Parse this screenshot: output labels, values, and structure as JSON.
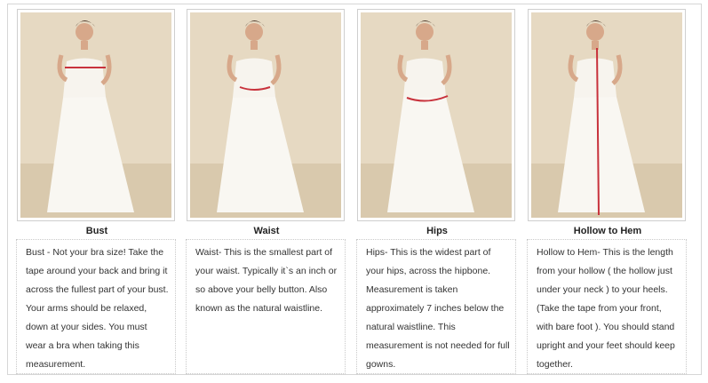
{
  "columns": [
    {
      "title": "Bust",
      "text": "Bust - Not your bra size! Take the tape around your back and bring it across the fullest part of your bust. Your arms should be relaxed, down at your sides. You must wear a bra when taking this measurement."
    },
    {
      "title": "Waist",
      "text": "Waist- This is the smallest part of your waist. Typically it`s an inch or so above your belly button. Also known as the natural waistline."
    },
    {
      "title": "Hips",
      "text": "Hips- This is the widest part of your hips, across the hipbone. Measurement is taken approximately 7 inches below the natural waistline. This measurement is not needed for full gowns."
    },
    {
      "title": "Hollow to Hem",
      "text": "Hollow to Hem- This is the length from your hollow ( the hollow just under your neck ) to your heels. (Take the tape from your front, with bare foot ). You should stand upright and your feet should keep together."
    }
  ],
  "colors": {
    "measure_line": "#c8323c",
    "background": "#e6d9c2"
  }
}
